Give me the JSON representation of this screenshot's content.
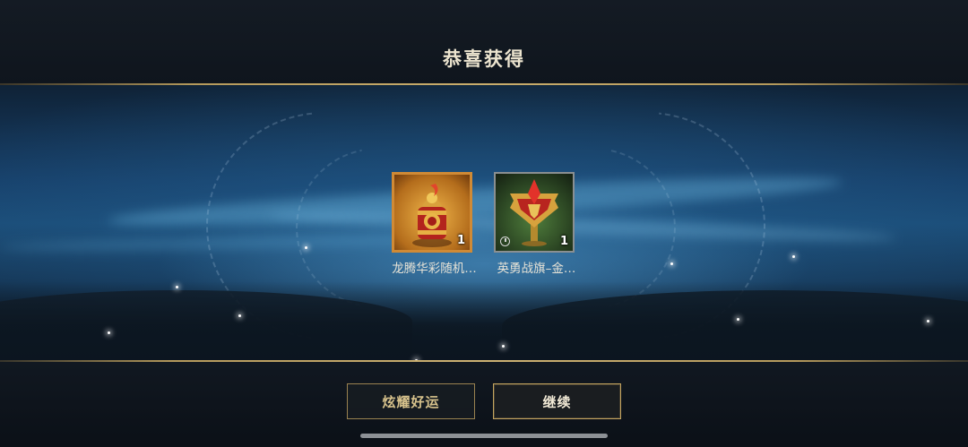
{
  "header": {
    "title": "恭喜获得"
  },
  "rewards": [
    {
      "name": "龙腾华彩随机…",
      "count": "1",
      "icon": "dragon-lantern-chest-icon",
      "rarity_color": "#d08a35"
    },
    {
      "name": "英勇战旗–金…",
      "count": "1",
      "icon": "gold-valor-banner-icon",
      "timed": true,
      "rarity_color": "#8a8f91"
    }
  ],
  "actions": {
    "share_label": "炫耀好运",
    "continue_label": "继续"
  },
  "colors": {
    "accent_gold": "#c9ad6c",
    "background": "#0d1219"
  }
}
